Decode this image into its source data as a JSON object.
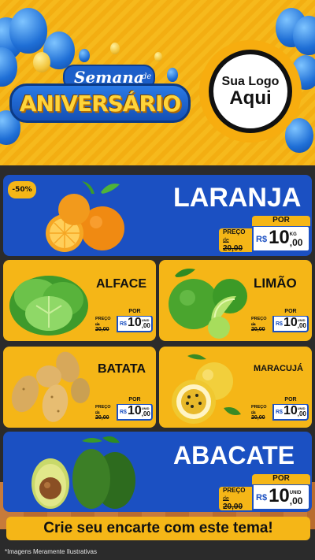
{
  "header": {
    "title_semana": "Semana",
    "title_de": "de",
    "title_aniversario": "ANIVERSÁRIO",
    "logo_line1": "Sua Logo",
    "logo_line2": "Aqui"
  },
  "colors": {
    "blue": "#1b50c2",
    "yellow": "#f5b617",
    "dark": "#2b2b2b"
  },
  "products": {
    "laranja": {
      "name": "LARANJA",
      "badge": "-50%",
      "por": "POR",
      "preco_label": "PREÇO",
      "de": "de",
      "old_price": "20,00",
      "currency": "R$",
      "price_int": "10",
      "price_cents": ",00",
      "unit": "KG",
      "icon": "orange-fruit-icon"
    },
    "alface": {
      "name": "ALFACE",
      "por": "POR",
      "preco_label": "PREÇO",
      "de": "de",
      "old_price": "20,00",
      "currency": "R$",
      "price_int": "10",
      "price_cents": ",00",
      "unit": "UNID",
      "icon": "lettuce-icon"
    },
    "limao": {
      "name": "LIMÃO",
      "por": "POR",
      "preco_label": "PREÇO",
      "de": "de",
      "old_price": "20,00",
      "currency": "R$",
      "price_int": "10",
      "price_cents": ",00",
      "unit": "UNID",
      "icon": "lime-icon"
    },
    "batata": {
      "name": "BATATA",
      "por": "POR",
      "preco_label": "PREÇO",
      "de": "de",
      "old_price": "20,00",
      "currency": "R$",
      "price_int": "10",
      "price_cents": ",00",
      "unit": "UNID",
      "icon": "potato-icon"
    },
    "maracuja": {
      "name": "MARACUJÁ",
      "por": "POR",
      "preco_label": "PREÇO",
      "de": "de",
      "old_price": "20,00",
      "currency": "R$",
      "price_int": "10",
      "price_cents": ",00",
      "unit": "UNID",
      "icon": "passion-fruit-icon"
    },
    "abacate": {
      "name": "ABACATE",
      "por": "POR",
      "preco_label": "PREÇO",
      "de": "de",
      "old_price": "20,00",
      "currency": "R$",
      "price_int": "10",
      "price_cents": ",00",
      "unit": "UNID",
      "icon": "avocado-icon"
    }
  },
  "footer": {
    "banner": "Crie seu encarte com este tema!",
    "note": "*Imagens Meramente Ilustrativas"
  }
}
